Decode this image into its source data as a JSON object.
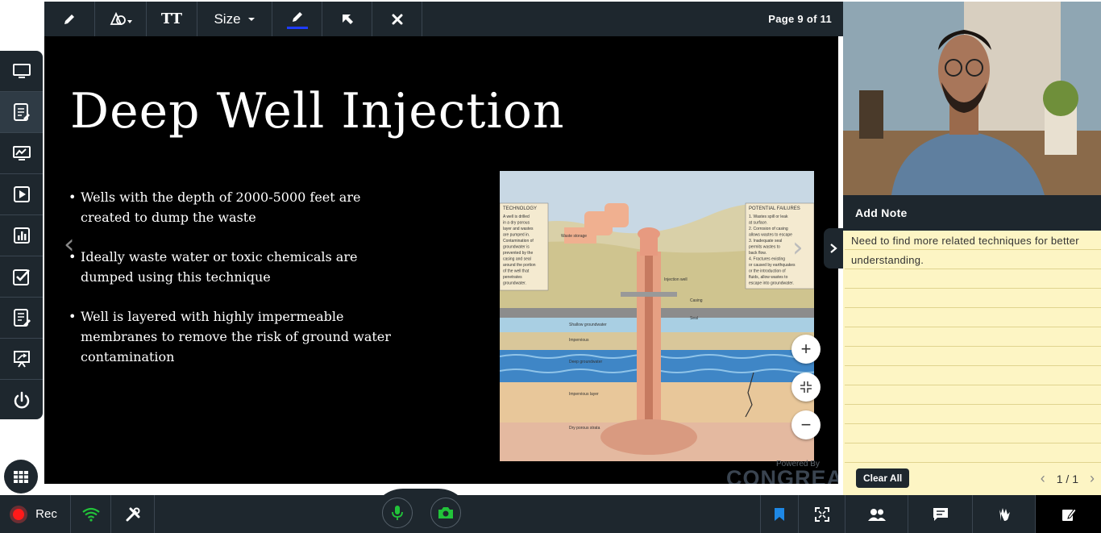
{
  "toolbar": {
    "tools": [
      "pencil-icon",
      "shapes-icon",
      "text-size-icon",
      "size-dropdown",
      "color-pen-icon",
      "pointer-icon",
      "clear-icon"
    ],
    "text_tool_label": "TT",
    "size_label": "Size",
    "page_info": "Page  9 of 11",
    "pen_color": "#1f3cff"
  },
  "sidebar": {
    "items": [
      "screen-share-icon",
      "whiteboard-icon",
      "analytics-icon",
      "media-player-icon",
      "poll-icon",
      "quiz-icon",
      "notes-icon",
      "presentation-icon",
      "power-icon"
    ],
    "active_index": 1
  },
  "slide": {
    "title": "Deep Well Injection",
    "bullets": [
      "Wells with the depth of 2000-5000 feet are created to dump the waste",
      "Ideally waste water or toxic chemicals are dumped using this technique",
      "Well is layered with highly impermeable membranes to remove the risk of ground water contamination"
    ],
    "diagram": {
      "technology_heading": "TECHNOLOGY",
      "technology_text": [
        "A well is drilled",
        "in a dry porous",
        "layer and wastes",
        "are pumped in.",
        "Contamination of",
        "groundwater is",
        "prevented by the",
        "casing and seal",
        "around the portion",
        "of the well that",
        "penetrates",
        "groundwater."
      ],
      "failures_heading": "POTENTIAL FAILURES",
      "failures_text": [
        "1. Wastes spill or leak",
        "   at surface.",
        "2. Corrosion of casing",
        "   allows wastes to escape",
        "3. Inadequate seal",
        "   permits wastes to",
        "   back flow.",
        "4. Fractures existing",
        "   or caused by earthquakes",
        "   or the introduction of",
        "   fluids, allow wastes to",
        "   escape into groundwater."
      ],
      "labels": {
        "waste_storage": "Waste storage",
        "injection_well": "Injection well",
        "casing": "Casing",
        "seal": "Seal",
        "shallow_groundwater": "Shallow groundwater",
        "impervious": "Impervious",
        "deep_groundwater": "Deep groundwater",
        "impervious_layer": "Impervious layer",
        "dry_porous_strata": "Dry porous strata"
      }
    },
    "zoom_in": "+",
    "zoom_out": "−",
    "powered_by": "Powered By",
    "brand": "CONGREA"
  },
  "notes": {
    "header": "Add Note",
    "text": "Need to find more related techniques for better understanding.",
    "clear_label": "Clear All",
    "pager": "1 / 1"
  },
  "bottombar": {
    "rec_label": "Rec",
    "left_icons": [
      "network-icon",
      "settings-icon"
    ],
    "right_icons": [
      "bookmark-icon",
      "fullscreen-icon",
      "participants-icon",
      "chat-icon",
      "raise-hand-icon",
      "notes-icon"
    ],
    "active_right": "notes-icon"
  },
  "colors": {
    "bar": "#1e272e",
    "note_bg": "#fdf5c4",
    "rec": "#ff1a1a",
    "mic": "#22c33a",
    "bookmark": "#1e88e5"
  }
}
